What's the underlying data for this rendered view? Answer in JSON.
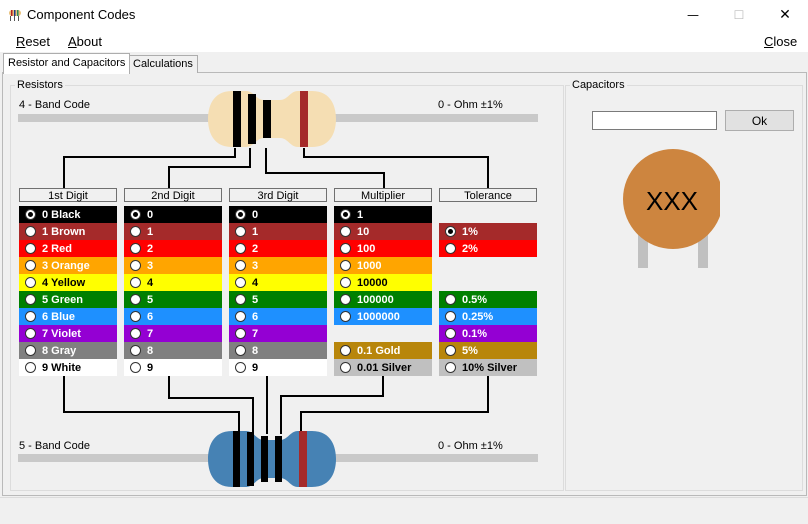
{
  "window": {
    "title": "Component Codes",
    "icon": "resistor-app-icon",
    "minimize_glyph": "—",
    "maximize_glyph": "☐",
    "close_glyph": "✕"
  },
  "menu": {
    "reset": {
      "first": "R",
      "rest": "eset"
    },
    "about": {
      "first": "A",
      "rest": "bout"
    },
    "close": {
      "first": "C",
      "rest": "lose"
    }
  },
  "tabs": [
    {
      "label": "Resistor and Capacitors",
      "active": true
    },
    {
      "label": "Calculations",
      "active": false
    }
  ],
  "resistors": {
    "group_label": "Resistors",
    "four_band_label": "4 - Band Code",
    "four_band_value": "0 - Ohm ±1%",
    "five_band_label": "5 - Band Code",
    "five_band_value": "0 - Ohm ±1%",
    "four_band_colors": [
      "#000000",
      "#000000",
      "#000000",
      "#a52a2a"
    ],
    "five_band_colors": [
      "#000000",
      "#000000",
      "#000000",
      "#000000",
      "#a52a2a"
    ],
    "body_color_4": "#f5deb3",
    "body_color_5": "#4682b4",
    "columns": [
      {
        "header": "1st Digit",
        "rows": [
          {
            "label": "0 Black",
            "bg": "#000000",
            "fg": "#ffffff",
            "checked": true
          },
          {
            "label": "1 Brown",
            "bg": "#a52a2a",
            "fg": "#ffffff"
          },
          {
            "label": "2 Red",
            "bg": "#ff0000",
            "fg": "#ffffff"
          },
          {
            "label": "3 Orange",
            "bg": "#ffa500",
            "fg": "#ffffff"
          },
          {
            "label": "4 Yellow",
            "bg": "#ffff00",
            "fg": "#000000"
          },
          {
            "label": "5 Green",
            "bg": "#008000",
            "fg": "#ffffff"
          },
          {
            "label": "6 Blue",
            "bg": "#1e90ff",
            "fg": "#ffffff"
          },
          {
            "label": "7 Violet",
            "bg": "#9400d3",
            "fg": "#ffffff"
          },
          {
            "label": "8 Gray",
            "bg": "#808080",
            "fg": "#ffffff"
          },
          {
            "label": "9 White",
            "bg": "#ffffff",
            "fg": "#000000"
          }
        ]
      },
      {
        "header": "2nd Digit",
        "rows": [
          {
            "label": "0",
            "bg": "#000000",
            "fg": "#ffffff",
            "checked": true
          },
          {
            "label": "1",
            "bg": "#a52a2a",
            "fg": "#ffffff"
          },
          {
            "label": "2",
            "bg": "#ff0000",
            "fg": "#ffffff"
          },
          {
            "label": "3",
            "bg": "#ffa500",
            "fg": "#ffffff"
          },
          {
            "label": "4",
            "bg": "#ffff00",
            "fg": "#000000"
          },
          {
            "label": "5",
            "bg": "#008000",
            "fg": "#ffffff"
          },
          {
            "label": "6",
            "bg": "#1e90ff",
            "fg": "#ffffff"
          },
          {
            "label": "7",
            "bg": "#9400d3",
            "fg": "#ffffff"
          },
          {
            "label": "8",
            "bg": "#808080",
            "fg": "#ffffff"
          },
          {
            "label": "9",
            "bg": "#ffffff",
            "fg": "#000000"
          }
        ]
      },
      {
        "header": "3rd Digit",
        "rows": [
          {
            "label": "0",
            "bg": "#000000",
            "fg": "#ffffff",
            "checked": true
          },
          {
            "label": "1",
            "bg": "#a52a2a",
            "fg": "#ffffff"
          },
          {
            "label": "2",
            "bg": "#ff0000",
            "fg": "#ffffff"
          },
          {
            "label": "3",
            "bg": "#ffa500",
            "fg": "#ffffff"
          },
          {
            "label": "4",
            "bg": "#ffff00",
            "fg": "#000000"
          },
          {
            "label": "5",
            "bg": "#008000",
            "fg": "#ffffff"
          },
          {
            "label": "6",
            "bg": "#1e90ff",
            "fg": "#ffffff"
          },
          {
            "label": "7",
            "bg": "#9400d3",
            "fg": "#ffffff"
          },
          {
            "label": "8",
            "bg": "#808080",
            "fg": "#ffffff"
          },
          {
            "label": "9",
            "bg": "#ffffff",
            "fg": "#000000"
          }
        ]
      },
      {
        "header": "Multiplier",
        "rows": [
          {
            "label": "1",
            "bg": "#000000",
            "fg": "#ffffff",
            "checked": true
          },
          {
            "label": "10",
            "bg": "#a52a2a",
            "fg": "#ffffff"
          },
          {
            "label": "100",
            "bg": "#ff0000",
            "fg": "#ffffff"
          },
          {
            "label": "1000",
            "bg": "#ffa500",
            "fg": "#ffffff"
          },
          {
            "label": "10000",
            "bg": "#ffff00",
            "fg": "#000000"
          },
          {
            "label": "100000",
            "bg": "#008000",
            "fg": "#ffffff"
          },
          {
            "label": "1000000",
            "bg": "#1e90ff",
            "fg": "#ffffff"
          },
          null,
          {
            "label": "0.1 Gold",
            "bg": "#b8860b",
            "fg": "#ffffff"
          },
          {
            "label": "0.01 Silver",
            "bg": "#c0c0c0",
            "fg": "#000000"
          }
        ]
      },
      {
        "header": "Tolerance",
        "rows": [
          null,
          {
            "label": "1%",
            "bg": "#a52a2a",
            "fg": "#ffffff",
            "checked": true
          },
          {
            "label": "2%",
            "bg": "#ff0000",
            "fg": "#ffffff"
          },
          null,
          null,
          {
            "label": "0.5%",
            "bg": "#008000",
            "fg": "#ffffff"
          },
          {
            "label": "0.25%",
            "bg": "#1e90ff",
            "fg": "#ffffff"
          },
          {
            "label": "0.1%",
            "bg": "#9400d3",
            "fg": "#ffffff"
          },
          {
            "label": "5%",
            "bg": "#b8860b",
            "fg": "#ffffff"
          },
          {
            "label": "10% Silver",
            "bg": "#c0c0c0",
            "fg": "#000000"
          }
        ]
      }
    ]
  },
  "capacitors": {
    "group_label": "Capacitors",
    "input_value": "",
    "ok_label": "Ok",
    "cap_text": "XXX",
    "cap_color": "#cd853f"
  }
}
